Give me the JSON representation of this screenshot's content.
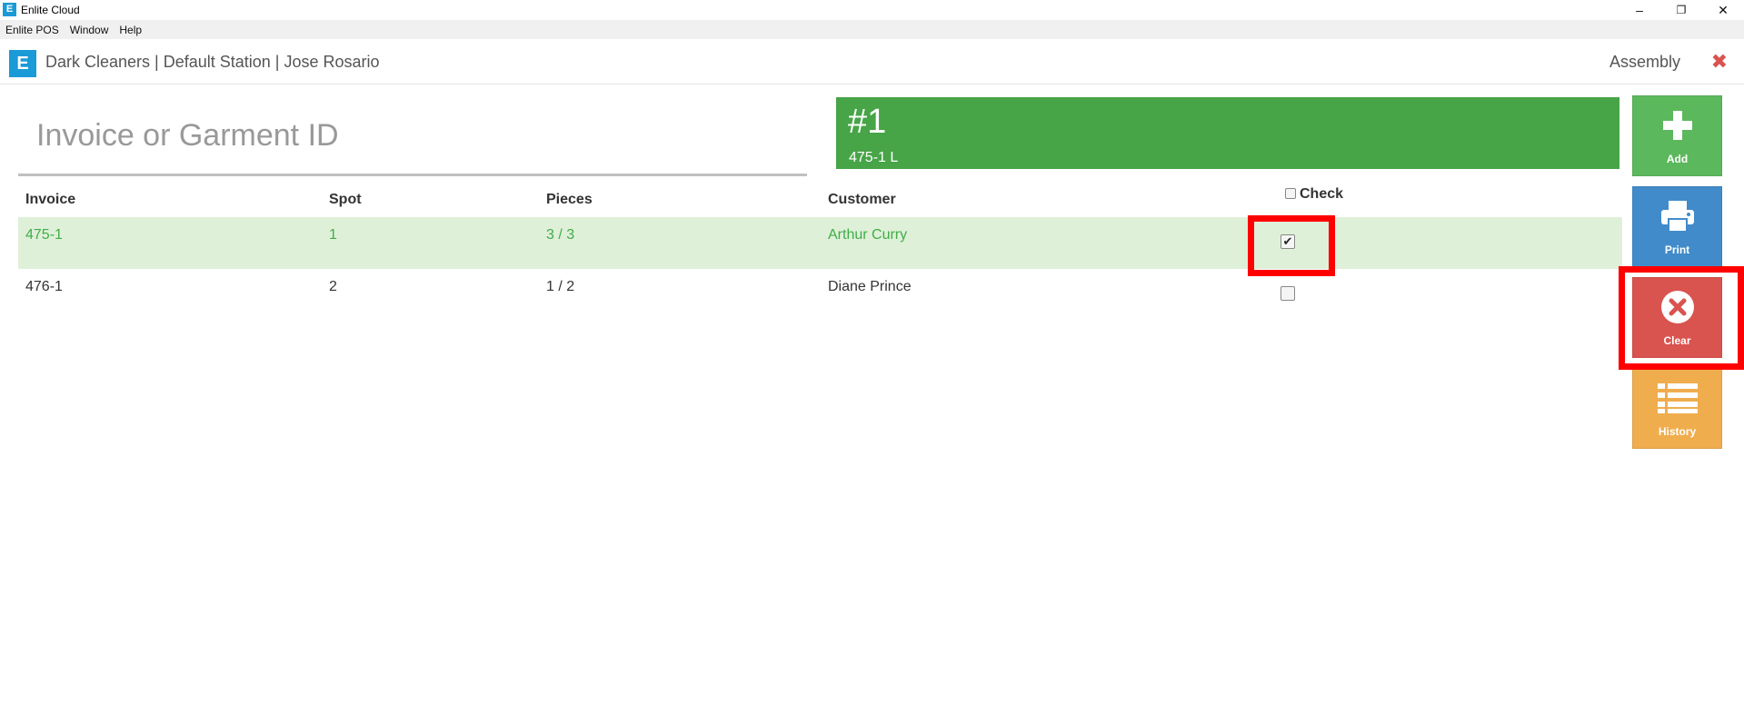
{
  "window": {
    "title": "Enlite Cloud",
    "app_icon_letter": "E",
    "minimize": "–",
    "restore": "❐",
    "close": "✕"
  },
  "menu": [
    "Enlite POS",
    "Window",
    "Help"
  ],
  "header": {
    "logo_letter": "E",
    "station": "Dark Cleaners | Default Station | Jose Rosario",
    "mode": "Assembly",
    "close_icon": "✖"
  },
  "search": {
    "placeholder": "Invoice or Garment ID",
    "value": ""
  },
  "order": {
    "number": "#1",
    "detail": "475-1 L"
  },
  "table": {
    "headers": {
      "invoice": "Invoice",
      "spot": "Spot",
      "pieces": "Pieces",
      "customer": "Customer",
      "check": "Check"
    },
    "rows": [
      {
        "invoice": "475-1",
        "spot": "1",
        "pieces": "3 / 3",
        "customer": "Arthur Curry",
        "checked": true,
        "selected": true
      },
      {
        "invoice": "476-1",
        "spot": "2",
        "pieces": "1 / 2",
        "customer": "Diane Prince",
        "checked": false,
        "selected": false
      }
    ]
  },
  "buttons": {
    "add": "Add",
    "print": "Print",
    "clear": "Clear",
    "history": "History"
  },
  "colors": {
    "brand": "#1a9ad6",
    "order_panel": "#47a447",
    "add": "#5cb85c",
    "print": "#428bca",
    "clear": "#d9534f",
    "history": "#f0ad4e",
    "selected_row": "#dff0d8",
    "highlight": "#ff0000"
  }
}
